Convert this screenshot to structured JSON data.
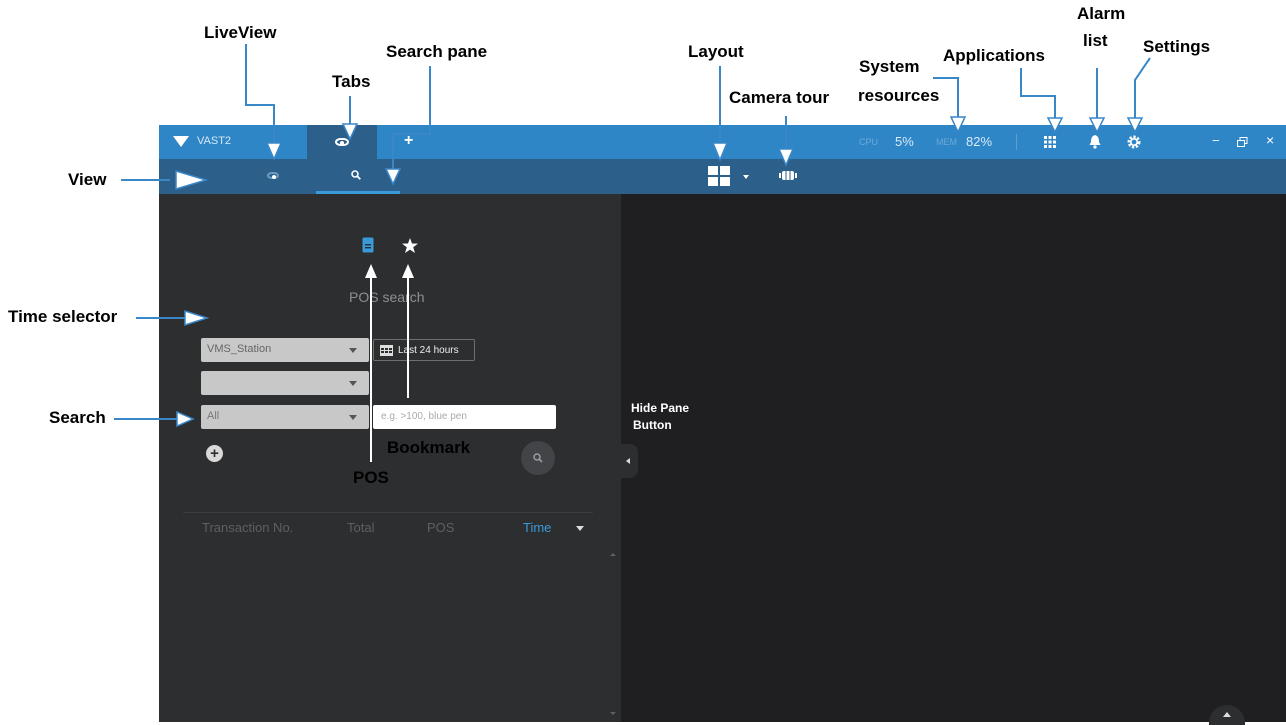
{
  "titlebar": {
    "app_name": "VAST2",
    "add_tab": "+",
    "cpu_label": "CPU",
    "cpu_value": "5%",
    "mem_label": "MEM",
    "mem_value": "82%",
    "minimize": "−",
    "close": "×"
  },
  "pos_search": {
    "title": "POS search",
    "station_select": "VMS_Station",
    "time_button": "Last 24 hours",
    "filter_select": "All",
    "search_placeholder": "e.g. >100, blue pen",
    "add_button": "+",
    "columns": [
      "Transaction No.",
      "Total",
      "POS",
      "Time"
    ]
  },
  "annotations": {
    "liveview": "LiveView",
    "tabs": "Tabs",
    "search_pane": "Search pane",
    "layout": "Layout",
    "camera_tour": "Camera tour",
    "system_resources_1": "System",
    "system_resources_2": "resources",
    "applications": "Applications",
    "alarm_list_1": "Alarm",
    "alarm_list_2": "list",
    "settings": "Settings",
    "view": "View",
    "time_selector": "Time selector",
    "search": "Search",
    "bookmark": "Bookmark",
    "pos": "POS",
    "hide_pane_1": "Hide Pane",
    "hide_pane_2": "Button"
  },
  "colors": {
    "titlebar": "#2f86c7",
    "subbar": "#2c5f89",
    "pane": "#2d2e30",
    "accent": "#3a9ad9",
    "arrow": "#3a87c8"
  }
}
